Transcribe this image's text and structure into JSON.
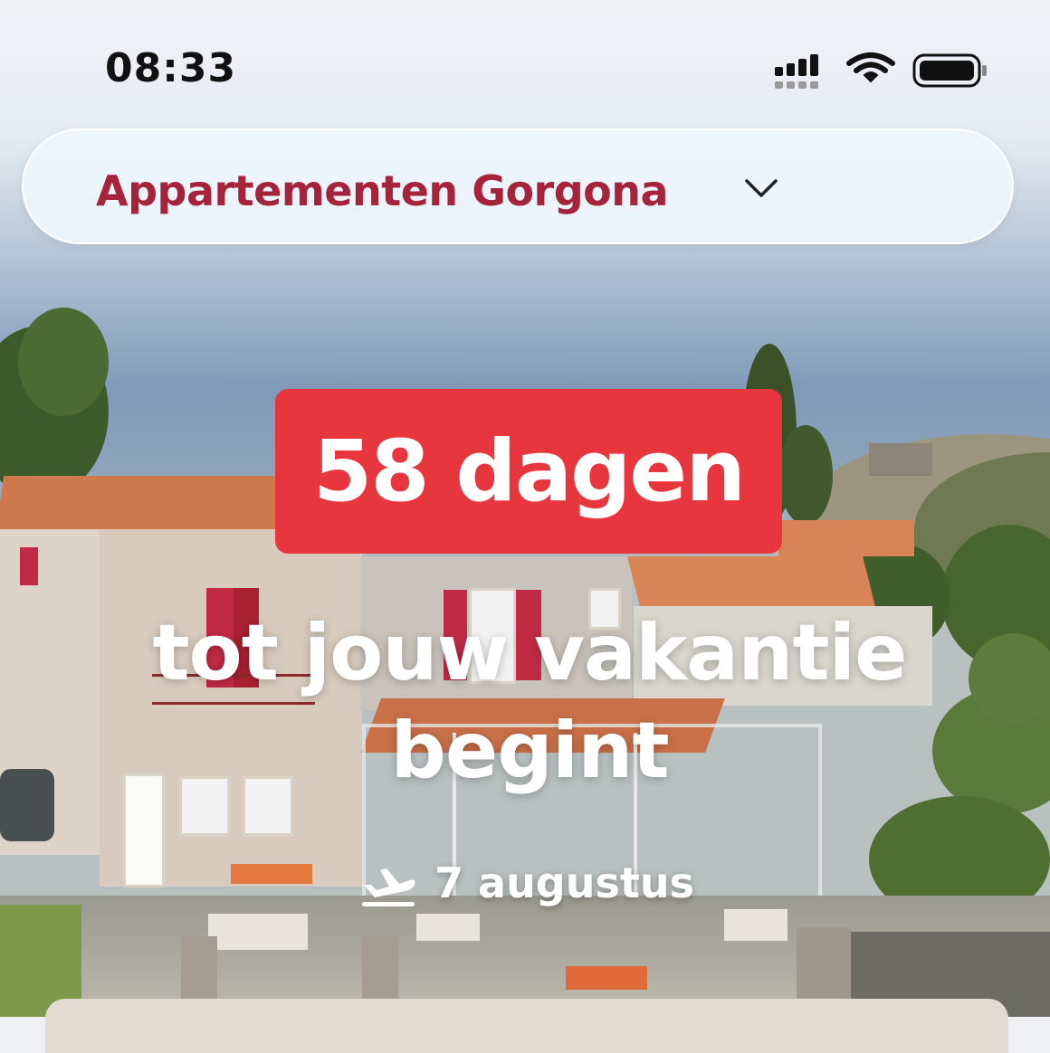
{
  "status_bar": {
    "time": "08:33",
    "icons": [
      "signal-icon",
      "wifi-icon",
      "battery-icon"
    ]
  },
  "location": {
    "name": "Appartementen Gorgona",
    "icon": "chevron-down-icon"
  },
  "countdown": {
    "days_label": "58 dagen",
    "subtitle": "tot jouw vakantie begint",
    "departure_icon": "plane-departure-icon",
    "departure_date": "7 augustus"
  },
  "colors": {
    "accent": "#a5233b",
    "badge": "#e8363f"
  }
}
